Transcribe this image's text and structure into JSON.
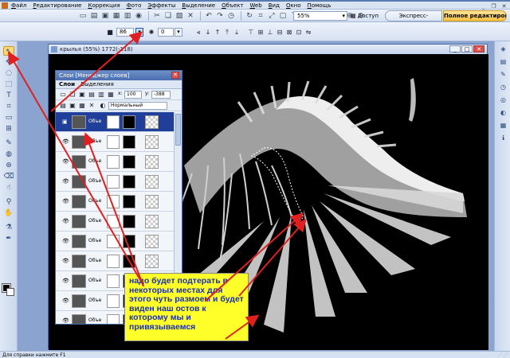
{
  "menu": {
    "items": [
      "Файл",
      "Редактирование",
      "Коррекция",
      "Фото",
      "Эффекты",
      "Выделение",
      "Объект",
      "Web",
      "Вид",
      "Окно",
      "Помощь"
    ]
  },
  "toolbar": {
    "zoom_value": "55%",
    "access_label": "Доступ",
    "express_label": "Экспресс-коррекция",
    "full_edit_label": "Полное редактиров..."
  },
  "options_bar": {
    "brush_size": "86",
    "hardness": "0"
  },
  "image_window": {
    "title": "крылья (55%) 1772(-118)"
  },
  "layers_panel": {
    "title": "Слои [Менеджер слоев]",
    "tabs": [
      "Слои",
      "Выделения"
    ],
    "x_label": "x:",
    "x_value": "100",
    "y_label": "y:",
    "y_value": "-388",
    "blend_mode": "Нормальный",
    "layers": [
      {
        "name": "Объе"
      },
      {
        "name": "Объе"
      },
      {
        "name": "Объе"
      },
      {
        "name": "Объе"
      },
      {
        "name": "Объе"
      },
      {
        "name": "Объе"
      },
      {
        "name": "Объе"
      },
      {
        "name": "Объе"
      },
      {
        "name": "Объе"
      },
      {
        "name": "Объе"
      },
      {
        "name": "Объе"
      }
    ]
  },
  "callout": {
    "text": "надо будет подтерать в некоторых местах для этого чуть размоем и будет виден наш  остов к которому мы и привязываемся"
  },
  "status": {
    "text": "Для справки нажмите F1"
  },
  "colors": {
    "callout_bg": "#ffff2a",
    "callout_text": "#1a2fb0",
    "arrow": "#e02020",
    "selected_layer": "#1f3f9a"
  }
}
